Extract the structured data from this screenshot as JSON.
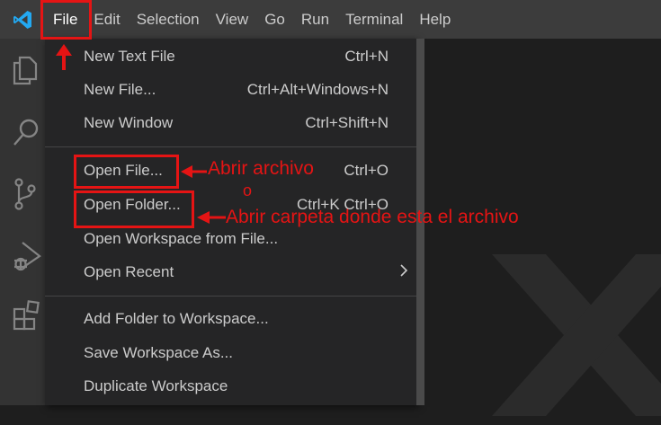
{
  "menubar": {
    "logo_icon": "vscode-logo-icon",
    "items": [
      "File",
      "Edit",
      "Selection",
      "View",
      "Go",
      "Run",
      "Terminal",
      "Help"
    ]
  },
  "activitybar": {
    "icons": [
      "explorer-icon",
      "search-icon",
      "source-control-icon",
      "run-debug-icon",
      "extensions-icon"
    ]
  },
  "file_menu": {
    "group1": [
      {
        "label": "New Text File",
        "shortcut": "Ctrl+N"
      },
      {
        "label": "New File...",
        "shortcut": "Ctrl+Alt+Windows+N"
      },
      {
        "label": "New Window",
        "shortcut": "Ctrl+Shift+N"
      }
    ],
    "group2": [
      {
        "label": "Open File...",
        "shortcut": "Ctrl+O"
      },
      {
        "label": "Open Folder...",
        "shortcut": "Ctrl+K Ctrl+O"
      },
      {
        "label": "Open Workspace from File...",
        "shortcut": ""
      },
      {
        "label": "Open Recent",
        "shortcut": ""
      }
    ],
    "group3": [
      {
        "label": "Add Folder to Workspace..."
      },
      {
        "label": "Save Workspace As..."
      },
      {
        "label": "Duplicate Workspace"
      }
    ]
  },
  "annotations": {
    "open_file_note": "Abrir archivo",
    "or_note": "o",
    "open_folder_note": "Abrir carpeta donde esta el archivo",
    "color": "#e51414"
  }
}
